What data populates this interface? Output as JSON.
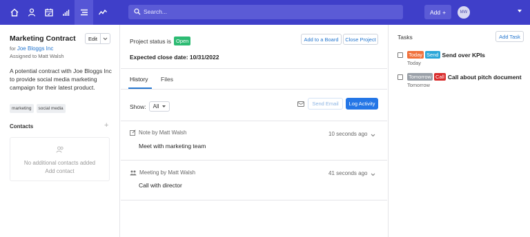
{
  "topbar": {
    "search_placeholder": "Search...",
    "add_label": "Add",
    "avatar_initials": "MW",
    "nav_icons": [
      "home-icon",
      "person-icon",
      "calendar-icon",
      "bar-chart-icon",
      "list-icon",
      "activity-icon"
    ],
    "colors": {
      "bar": "#3f3fc9",
      "field": "#5b5bd6"
    }
  },
  "record": {
    "title": "Marketing Contract",
    "edit_label": "Edit",
    "for_prefix": "for",
    "for_link": "Joe Bloggs Inc",
    "assigned": "Assigned to Matt Walsh",
    "description": "A potential contract with Joe Bloggs Inc to provide social media marketing campaign for their latest product.",
    "tags": [
      "marketing",
      "social media"
    ]
  },
  "contacts": {
    "heading": "Contacts",
    "empty_line1": "No additional contacts added",
    "empty_line2": "Add contact"
  },
  "project": {
    "status_label": "Project status is",
    "status_value": "Open",
    "add_board": "Add to a Board",
    "close_project": "Close Project",
    "close_date": "Expected close date: 10/31/2022"
  },
  "tabs": [
    "History",
    "Files"
  ],
  "filter": {
    "show_label": "Show:",
    "show_value": "All",
    "send_email": "Send Email",
    "log_activity": "Log Activity"
  },
  "activities": [
    {
      "type": "Note by Matt Walsh",
      "time": "10 seconds ago",
      "text": "Meet with marketing team"
    },
    {
      "type": "Meeting by Matt Walsh",
      "time": "41 seconds ago",
      "text": "Call with director"
    }
  ],
  "tasks": {
    "heading": "Tasks",
    "add_label": "Add Task",
    "items": [
      {
        "chips": [
          {
            "label": "Today",
            "color": "#f0703a"
          },
          {
            "label": "Send",
            "color": "#2aa6d8"
          }
        ],
        "name": "Send over KPIs",
        "due": "Today"
      },
      {
        "chips": [
          {
            "label": "Tomorrow",
            "color": "#9aa0a8"
          },
          {
            "label": "Call",
            "color": "#d92b2b"
          }
        ],
        "name": "Call about pitch document",
        "due": "Tomorrow"
      }
    ]
  }
}
